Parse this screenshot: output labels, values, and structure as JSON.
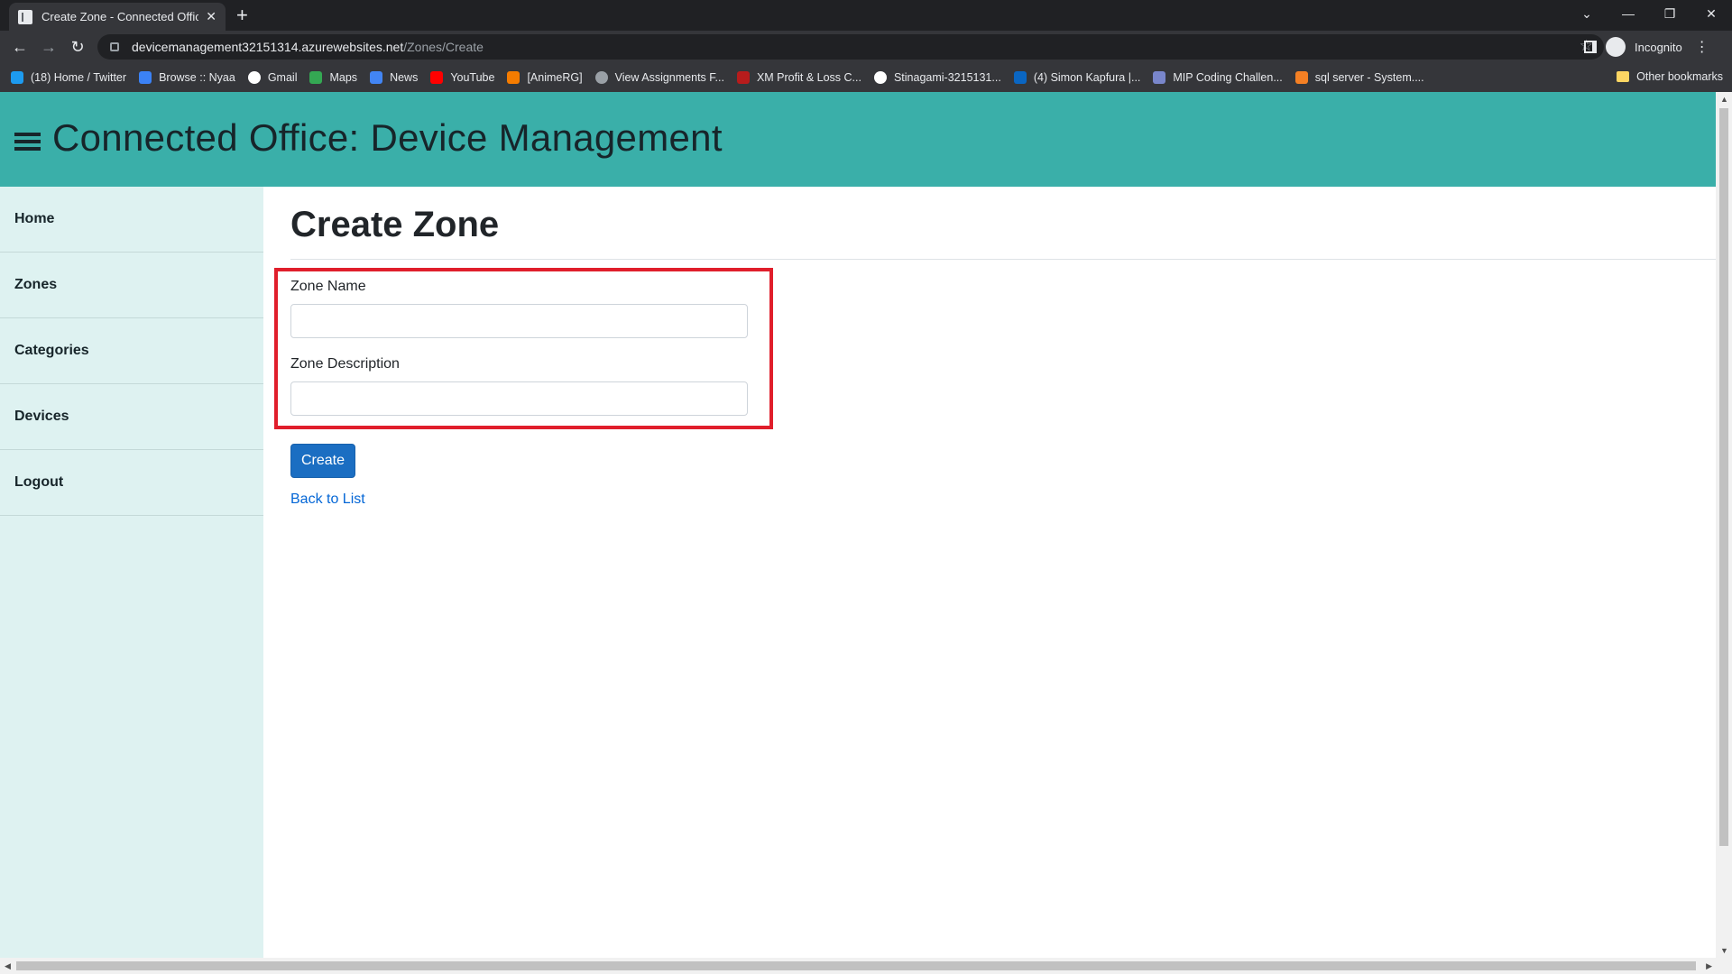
{
  "browser": {
    "tab_title": "Create Zone - Connected Office:",
    "tab_close": "✕",
    "new_tab": "+",
    "url_host": "devicemanagement32151314.azurewebsites.net",
    "url_path": "/Zones/Create",
    "profile_label": "Incognito",
    "bookmarks": [
      {
        "label": "(18) Home / Twitter",
        "color": "#1d9bf0"
      },
      {
        "label": "Browse :: Nyaa",
        "color": "#3b82f6"
      },
      {
        "label": "Gmail",
        "color": "#ffffff"
      },
      {
        "label": "Maps",
        "color": "#34a853"
      },
      {
        "label": "News",
        "color": "#4285f4"
      },
      {
        "label": "YouTube",
        "color": "#ff0000"
      },
      {
        "label": "[AnimeRG]",
        "color": "#f57c00"
      },
      {
        "label": "View Assignments F...",
        "color": "#9aa0a6"
      },
      {
        "label": "XM Profit & Loss C...",
        "color": "#b71c1c"
      },
      {
        "label": "Stinagami-3215131...",
        "color": "#ffffff"
      },
      {
        "label": "(4) Simon Kapfura |...",
        "color": "#0a66c2"
      },
      {
        "label": "MIP Coding Challen...",
        "color": "#7986cb"
      },
      {
        "label": "sql server - System....",
        "color": "#f48024"
      }
    ],
    "other_bookmarks": "Other bookmarks"
  },
  "header": {
    "title": "Connected Office: Device Management"
  },
  "sidebar": {
    "items": [
      {
        "label": "Home"
      },
      {
        "label": "Zones"
      },
      {
        "label": "Categories"
      },
      {
        "label": "Devices"
      },
      {
        "label": "Logout"
      }
    ]
  },
  "form": {
    "page_title": "Create Zone",
    "zone_name_label": "Zone Name",
    "zone_name_value": "",
    "zone_description_label": "Zone Description",
    "zone_description_value": "",
    "submit_label": "Create",
    "back_link": "Back to List"
  },
  "colors": {
    "header_bg": "#3aafa9",
    "sidebar_bg": "#def2f1",
    "primary_button": "#1b6ec2",
    "highlight_border": "#e01e2b"
  }
}
